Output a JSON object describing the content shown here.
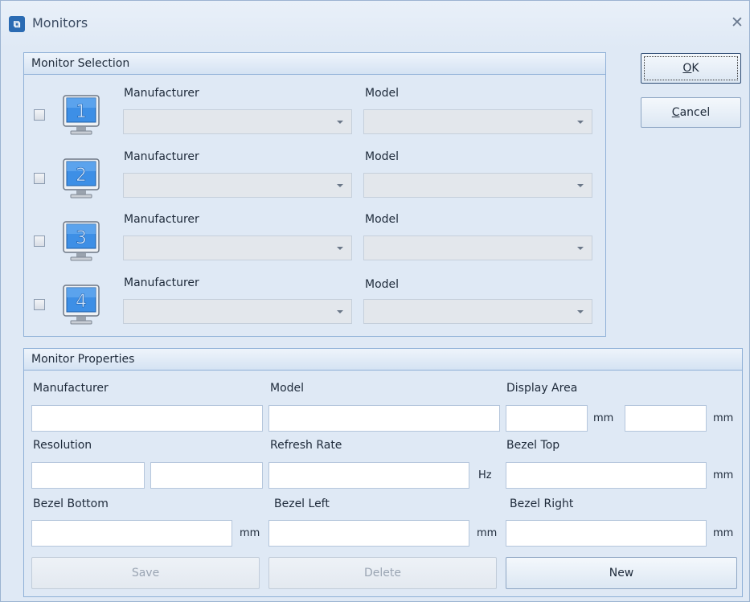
{
  "window": {
    "title": "Monitors",
    "app_icon_glyph": "⧉",
    "close_glyph": "✕"
  },
  "buttons": {
    "ok_label": "OK",
    "ok_mnemonic": "O",
    "cancel_label": "Cancel",
    "cancel_mnemonic": "C"
  },
  "monitor_selection": {
    "title": "Monitor Selection",
    "manufacturer_label": "Manufacturer",
    "model_label": "Model",
    "monitors": [
      {
        "number": "1",
        "checked": false,
        "manufacturer": "",
        "model": ""
      },
      {
        "number": "2",
        "checked": false,
        "manufacturer": "",
        "model": ""
      },
      {
        "number": "3",
        "checked": false,
        "manufacturer": "",
        "model": ""
      },
      {
        "number": "4",
        "checked": false,
        "manufacturer": "",
        "model": ""
      }
    ]
  },
  "monitor_properties": {
    "title": "Monitor Properties",
    "manufacturer_label": "Manufacturer",
    "model_label": "Model",
    "display_area_label": "Display Area",
    "resolution_label": "Resolution",
    "refresh_rate_label": "Refresh Rate",
    "bezel_top_label": "Bezel Top",
    "bezel_bottom_label": "Bezel Bottom",
    "bezel_left_label": "Bezel Left",
    "bezel_right_label": "Bezel Right",
    "unit_mm": "mm",
    "unit_hz": "Hz",
    "values": {
      "manufacturer": "",
      "model": "",
      "display_area_w": "",
      "display_area_h": "",
      "resolution_w": "",
      "resolution_h": "",
      "refresh_rate": "",
      "bezel_top": "",
      "bezel_bottom": "",
      "bezel_left": "",
      "bezel_right": ""
    },
    "save_label": "Save",
    "delete_label": "Delete",
    "new_label": "New"
  },
  "colors": {
    "window_bg": "#dfe9f5",
    "group_border": "#8fb0d7",
    "monitor_screen": "#3d8fe6",
    "app_icon": "#2b6bb3"
  }
}
